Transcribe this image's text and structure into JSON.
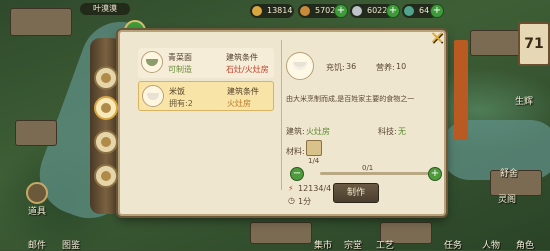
{
  "top_bar": {
    "player_label": "叶漠漠",
    "resource_1": "13814",
    "resource_2": "5702",
    "resource_3": "6022",
    "resource_4": "64",
    "right_number": "71"
  },
  "left_labels": {
    "mail": "邮件",
    "guide": "道具"
  },
  "right_labels": {
    "merchant": "生辉",
    "wine": "舒舍",
    "lantern": "灵阁"
  },
  "bottom_labels": [
    "邮件",
    "图鉴",
    "集市",
    "宗堂",
    "工艺",
    "任务",
    "人物",
    "角色"
  ],
  "colors": {
    "dialog_bg": "#efe6cf",
    "accent_green": "#5c8a2e",
    "accent_red": "#c0412a",
    "tab": "#b85a22"
  },
  "recipes": [
    {
      "name": "青菜面",
      "status": "可制造",
      "cond_label": "建筑条件",
      "cond_value": "石灶/火灶房"
    },
    {
      "name": "米饭",
      "status": "拥有:2",
      "cond_label": "建筑条件",
      "cond_value": "火灶房"
    }
  ],
  "detail": {
    "satiety_label": "充饥:",
    "satiety_value": "36",
    "nutrition_label": "营养:",
    "nutrition_value": "10",
    "description": "由大米烹制而成,是百姓家主要的食物之一",
    "building_label": "建筑:",
    "building_value": "火灶房",
    "tech_label": "科技:",
    "tech_value": "无",
    "materials_label": "材料:",
    "material_count": "1/4",
    "progress_text": "0/1",
    "cost": "12134/4",
    "time": "1分",
    "make_button": "制作"
  }
}
